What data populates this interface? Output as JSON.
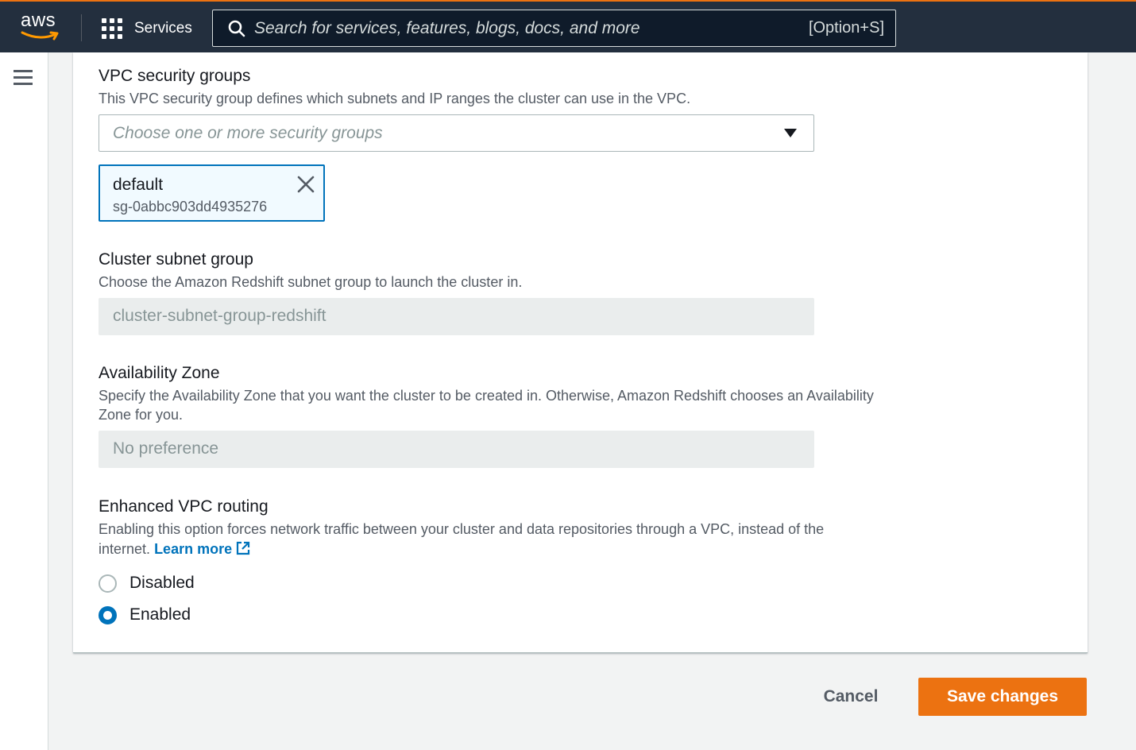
{
  "nav": {
    "logo_text": "aws",
    "services_label": "Services",
    "search_placeholder": "Search for services, features, blogs, docs, and more",
    "search_shortcut": "[Option+S]"
  },
  "security_groups": {
    "label": "VPC security groups",
    "description": "This VPC security group defines which subnets and IP ranges the cluster can use in the VPC.",
    "placeholder": "Choose one or more security groups",
    "selected": [
      {
        "name": "default",
        "id": "sg-0abbc903dd4935276"
      }
    ]
  },
  "subnet_group": {
    "label": "Cluster subnet group",
    "description": "Choose the Amazon Redshift subnet group to launch the cluster in.",
    "value": "cluster-subnet-group-redshift"
  },
  "availability_zone": {
    "label": "Availability Zone",
    "description_line1": "Specify the Availability Zone that you want the cluster to be created in. Otherwise, Amazon Redshift chooses an Availability",
    "description_line2": "Zone for you.",
    "value": "No preference"
  },
  "enhanced_vpc": {
    "label": "Enhanced VPC routing",
    "description_line1": "Enabling this option forces network traffic between your cluster and data repositories through a VPC, instead of the",
    "description_line2": "internet.",
    "learn_more": "Learn more",
    "options": [
      {
        "label": "Disabled",
        "checked": false
      },
      {
        "label": "Enabled",
        "checked": true
      }
    ]
  },
  "actions": {
    "cancel": "Cancel",
    "save": "Save changes"
  },
  "colors": {
    "nav_bg": "#232f3e",
    "accent_orange": "#ec7211",
    "link_blue": "#0073bb"
  }
}
